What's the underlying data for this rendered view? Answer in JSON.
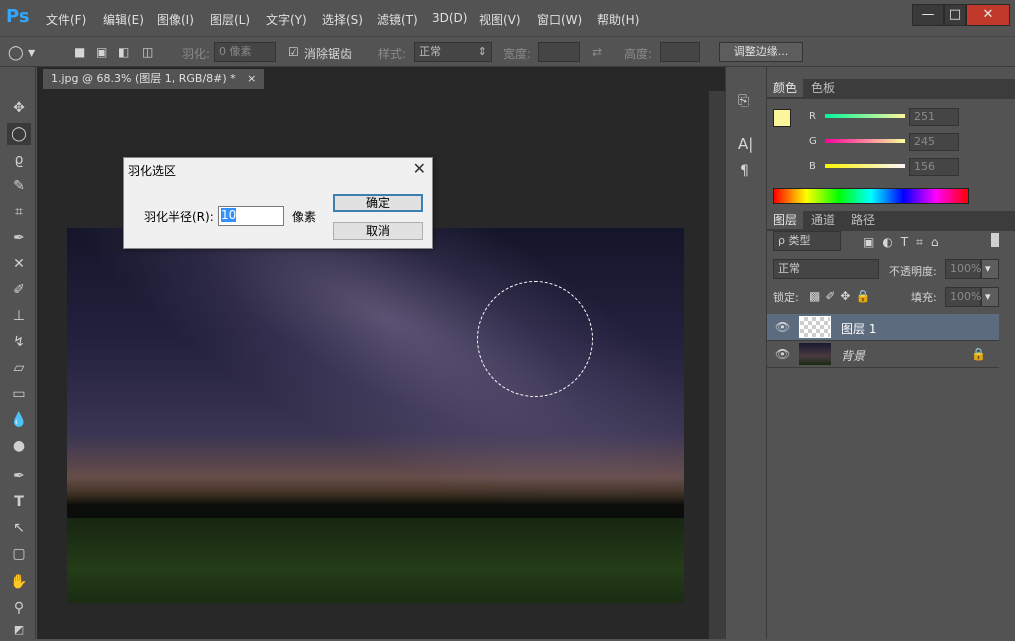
{
  "app": {
    "logo": "Ps",
    "menus": [
      "文件(F)",
      "编辑(E)",
      "图像(I)",
      "图层(L)",
      "文字(Y)",
      "选择(S)",
      "滤镜(T)",
      "3D(D)",
      "视图(V)",
      "窗口(W)",
      "帮助(H)"
    ],
    "window_controls": {
      "minimize": "—",
      "maximize": "□",
      "close": "✕"
    }
  },
  "options": {
    "feather_label": "羽化:",
    "feather_value": "0 像素",
    "antialias_label": "消除锯齿",
    "style_label": "样式:",
    "style_value": "正常",
    "width_label": "宽度:",
    "height_label": "高度:",
    "refine_edge_button": "调整边缘..."
  },
  "document": {
    "tab_title": "1.jpg @ 68.3% (图层 1, RGB/8#) *",
    "tab_close": "×"
  },
  "color_panel": {
    "tabs": [
      "颜色",
      "色板"
    ],
    "foreground": "#fbf59c",
    "r_label": "R",
    "r_value": "251",
    "g_label": "G",
    "g_value": "245",
    "b_label": "B",
    "b_value": "156"
  },
  "layers_panel": {
    "tabs": [
      "图层",
      "通道",
      "路径"
    ],
    "filter_label": "ρ 类型",
    "blend_mode": "正常",
    "opacity_label": "不透明度:",
    "opacity_value": "100%",
    "lock_label": "锁定:",
    "fill_label": "填充:",
    "fill_value": "100%",
    "layers": [
      {
        "name": "图层 1",
        "selected": true
      },
      {
        "name": "背景",
        "locked": true
      }
    ]
  },
  "dialog": {
    "title": "羽化选区",
    "radius_label": "羽化半径(R):",
    "radius_value": "10",
    "unit": "像素",
    "ok_button": "确定",
    "cancel_button": "取消",
    "close": "✕"
  }
}
